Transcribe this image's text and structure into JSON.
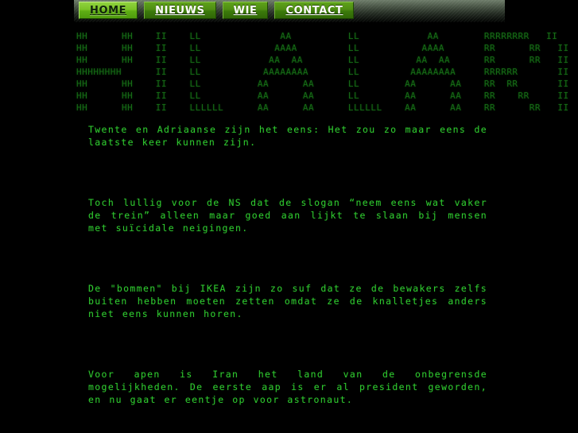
{
  "site": {
    "title": "Hilaria"
  },
  "nav": {
    "items": [
      {
        "label": "HOME",
        "active": true
      },
      {
        "label": "NIEUWS",
        "active": false
      },
      {
        "label": "WIE",
        "active": false
      },
      {
        "label": "CONTACT",
        "active": false
      }
    ]
  },
  "banner": {
    "word": "HILARIA",
    "ascii": "HH      HH    II    LL              AA          LL            AA        RRRRRRRR   II        AA\nHH      HH    II    LL             AAAA         LL           AAAA       RR      RR   II       AAAA\nHH      HH    II    LL            AA  AA        LL          AA  AA      RR      RR   II      AA  AA\nHHHHHHHH      II    LL           AAAAAAAA       LL         AAAAAAAA     RRRRRR       II     AAAAAAAA\nHH      HH    II    LL          AA      AA      LL        AA      AA    RR  RR       II    AA      AA\nHH      HH    II    LL          AA      AA      LL        AA      AA    RR    RR     II    AA      AA\nHH      HH    II    LLLLLL      AA      AA      LLLLLL    AA      AA    RR      RR   II    AA      AA"
  },
  "posts": [
    {
      "text": "Twente en Adriaanse zijn het eens: Het zou zo maar eens de laatste keer kunnen zijn."
    },
    {
      "text": "Toch lullig voor de NS dat de slogan “neem eens wat vaker de trein” alleen maar goed aan lijkt te slaan bij mensen met suïcidale neigingen."
    },
    {
      "text": "De \"bommen\" bij IKEA zijn zo suf dat ze de bewakers zelfs buiten hebben moeten zetten omdat ze de knalletjes anders niet eens kunnen horen."
    },
    {
      "text": "Voor apen is Iran het land van de onbegrensde mogelijkheden. De eerste aap is er al president geworden, en nu gaat er eentje op voor astronaut."
    }
  ],
  "colors": {
    "background": "#000000",
    "body_text": "#2fc72f",
    "ascii_text": "#166b16",
    "button_green": "#4e8d13",
    "button_active_green": "#79c226"
  }
}
